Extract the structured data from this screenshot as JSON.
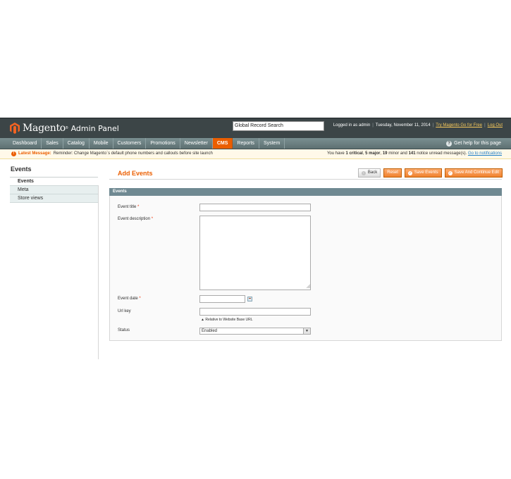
{
  "header": {
    "logo_text": "Magento",
    "logo_tm": "®",
    "logo_sub": "Admin Panel",
    "search_value": "Global Record Search",
    "logged_in": "Logged in as admin",
    "date": "Tuesday, November 11, 2014",
    "try_link": "Try Magento Go for Free",
    "logout": "Log Out"
  },
  "nav": {
    "items": [
      "Dashboard",
      "Sales",
      "Catalog",
      "Mobile",
      "Customers",
      "Promotions",
      "Newsletter",
      "CMS",
      "Reports",
      "System"
    ],
    "active": "CMS",
    "help": "Get help for this page"
  },
  "notice": {
    "label": "Latest Message:",
    "message": "Reminder: Change Magento`s default phone numbers and callouts before site launch",
    "summary_pre": "You have",
    "critical": "1 critical",
    "major": "5 major",
    "minor": "19",
    "minor_label": "minor and",
    "notice_count": "141",
    "summary_post": "notice unread message(s).",
    "link": "Go to notifications"
  },
  "sidebar": {
    "title": "Events",
    "tabs": [
      "Events",
      "Meta",
      "Store views"
    ]
  },
  "content": {
    "title": "Add Events",
    "buttons": {
      "back": "Back",
      "reset": "Reset",
      "save": "Save Events",
      "save_continue": "Save And Continue Edit"
    },
    "fieldset_title": "Events",
    "fields": {
      "title_label": "Event title",
      "description_label": "Event description",
      "date_label": "Event date",
      "url_label": "Url key",
      "url_note": "Relative to Website Base URL",
      "status_label": "Status",
      "status_value": "Enabled",
      "required_mark": "*"
    }
  },
  "colors": {
    "accent": "#eb5e00",
    "header_bg": "#3c4547",
    "nav_bg": "#6b7f81",
    "fieldset_head": "#6f8992"
  }
}
